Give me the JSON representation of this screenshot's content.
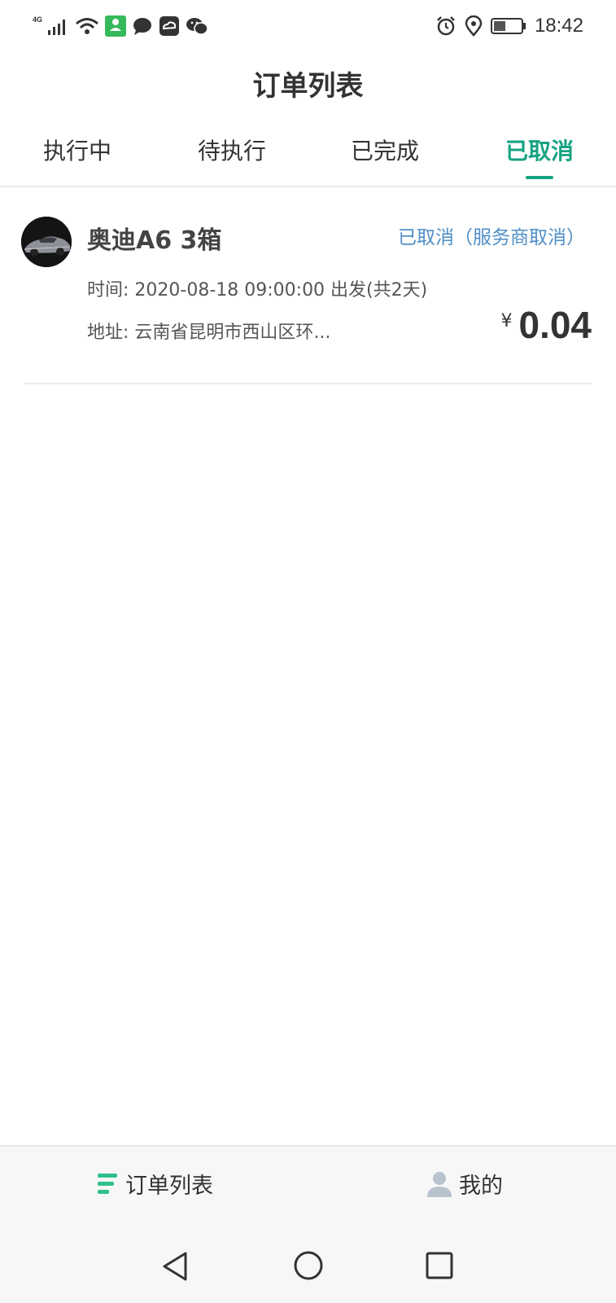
{
  "status_bar": {
    "network_label": "4G",
    "time": "18:42",
    "app_badge_label": "4G"
  },
  "header": {
    "title": "订单列表"
  },
  "tabs": [
    {
      "label": "执行中",
      "active": false
    },
    {
      "label": "待执行",
      "active": false
    },
    {
      "label": "已完成",
      "active": false
    },
    {
      "label": "已取消",
      "active": true
    }
  ],
  "orders": [
    {
      "car_name": "奥迪A6 3箱",
      "status": "已取消（服务商取消）",
      "time_line": "时间: 2020-08-18 09:00:00 出发(共2天)",
      "address_line": "地址: 云南省昆明市西山区环...",
      "currency": "¥",
      "amount": "0.04"
    }
  ],
  "bottom_tabs": [
    {
      "label": "订单列表",
      "icon": "list-icon"
    },
    {
      "label": "我的",
      "icon": "user-icon"
    }
  ],
  "colors": {
    "accent": "#17a383",
    "status_blue": "#4f8fc7",
    "tab_icon_green": "#2fc08a",
    "user_icon_grey": "#b9c3cf"
  }
}
